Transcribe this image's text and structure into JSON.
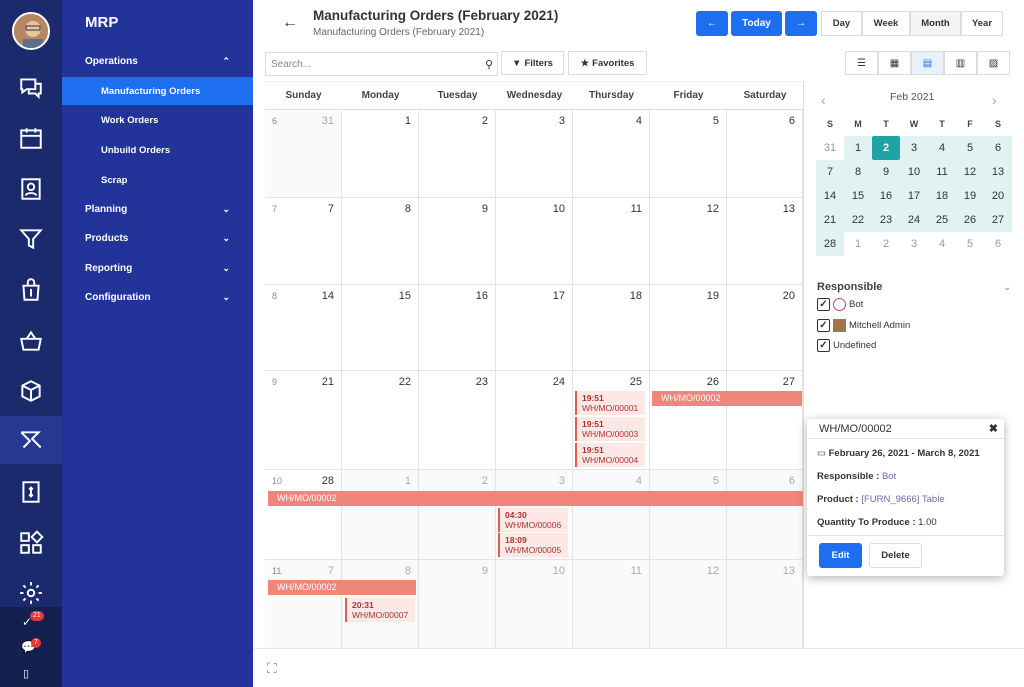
{
  "menu": {
    "app": "MRP",
    "sections": [
      {
        "label": "Operations",
        "chev": "^"
      },
      {
        "label": "Planning",
        "chev": "v"
      },
      {
        "label": "Products",
        "chev": "v"
      },
      {
        "label": "Reporting",
        "chev": "v"
      },
      {
        "label": "Configuration",
        "chev": "v"
      }
    ],
    "items": [
      "Manufacturing Orders",
      "Work Orders",
      "Unbuild Orders",
      "Scrap"
    ]
  },
  "rail": {
    "badges": [
      "21",
      "7"
    ],
    "icons": [
      "discuss-icon",
      "calendar-icon",
      "contacts-icon",
      "crm-filter-icon",
      "sales-bag-icon",
      "purchase-basket-icon",
      "inventory-box-icon",
      "manufacturing-icon",
      "invoicing-icon",
      "apps-icon",
      "settings-icon"
    ]
  },
  "header": {
    "title": "Manufacturing Orders (February 2021)",
    "subtitle": "Manufacturing Orders (February 2021)",
    "back": "←"
  },
  "nav": {
    "prev": "←",
    "today": "Today",
    "next": "→",
    "day": "Day",
    "week": "Week",
    "month": "Month",
    "year": "Year"
  },
  "search": {
    "placeholder": "Search..."
  },
  "filters": {
    "filters": "Filters",
    "favorites": "Favorites"
  },
  "calendar": {
    "days": [
      "Sunday",
      "Monday",
      "Tuesday",
      "Wednesday",
      "Thursday",
      "Friday",
      "Saturday"
    ],
    "weeks": [
      {
        "wk": "6",
        "dates": [
          "31",
          "1",
          "2",
          "3",
          "4",
          "5",
          "6"
        ],
        "dim": [
          true,
          false,
          false,
          false,
          false,
          false,
          false
        ]
      },
      {
        "wk": "7",
        "dates": [
          "7",
          "8",
          "9",
          "10",
          "11",
          "12",
          "13"
        ],
        "dim": [
          false,
          false,
          false,
          false,
          false,
          false,
          false
        ]
      },
      {
        "wk": "8",
        "dates": [
          "14",
          "15",
          "16",
          "17",
          "18",
          "19",
          "20"
        ],
        "dim": [
          false,
          false,
          false,
          false,
          false,
          false,
          false
        ]
      },
      {
        "wk": "9",
        "dates": [
          "21",
          "22",
          "23",
          "24",
          "25",
          "26",
          "27"
        ],
        "dim": [
          false,
          false,
          false,
          false,
          false,
          false,
          false
        ]
      },
      {
        "wk": "10",
        "dates": [
          "28",
          "1",
          "2",
          "3",
          "4",
          "5",
          "6"
        ],
        "dim": [
          false,
          true,
          true,
          true,
          true,
          true,
          true
        ]
      },
      {
        "wk": "11",
        "dates": [
          "7",
          "8",
          "9",
          "10",
          "11",
          "12",
          "13"
        ],
        "dim": [
          true,
          true,
          true,
          true,
          true,
          true,
          true
        ]
      }
    ],
    "events": {
      "e1": {
        "time": "19:51",
        "name": "WH/MO/00001"
      },
      "e2": {
        "time": "19:51",
        "name": "WH/MO/00003"
      },
      "e3": {
        "time": "19:51",
        "name": "WH/MO/00004"
      },
      "bar1": "WH/MO/00002",
      "bar2": "WH/MO/00002",
      "bar3": "WH/MO/00002",
      "e4": {
        "time": "04:30",
        "name": "WH/MO/00006"
      },
      "e5": {
        "time": "18:09",
        "name": "WH/MO/00005"
      },
      "e6": {
        "time": "20:31",
        "name": "WH/MO/00007"
      }
    }
  },
  "mini": {
    "month": "Feb 2021",
    "dh": [
      "S",
      "M",
      "T",
      "W",
      "T",
      "F",
      "S"
    ],
    "rows": [
      [
        "31",
        "1",
        "2",
        "3",
        "4",
        "5",
        "6"
      ],
      [
        "7",
        "8",
        "9",
        "10",
        "11",
        "12",
        "13"
      ],
      [
        "14",
        "15",
        "16",
        "17",
        "18",
        "19",
        "20"
      ],
      [
        "21",
        "22",
        "23",
        "24",
        "25",
        "26",
        "27"
      ],
      [
        "28",
        "1",
        "2",
        "3",
        "4",
        "5",
        "6"
      ]
    ]
  },
  "responsible": {
    "title": "Responsible",
    "items": [
      "Bot",
      "Mitchell Admin",
      "Undefined"
    ]
  },
  "popover": {
    "title": "WH/MO/00002",
    "dates": "February 26, 2021 - March 8, 2021",
    "resp_label": "Responsible :",
    "resp_val": "Bot",
    "prod_label": "Product :",
    "prod_val": "[FURN_9666] Table",
    "qty_label": "Quantity To Produce :",
    "qty_val": "1.00",
    "edit": "Edit",
    "delete": "Delete"
  },
  "colors": {
    "sidebar": "#22339a",
    "rail": "#1a2a6c",
    "accent": "#1e6ff0",
    "event": "#f0867a",
    "mini_sel": "#1fa3a3"
  }
}
